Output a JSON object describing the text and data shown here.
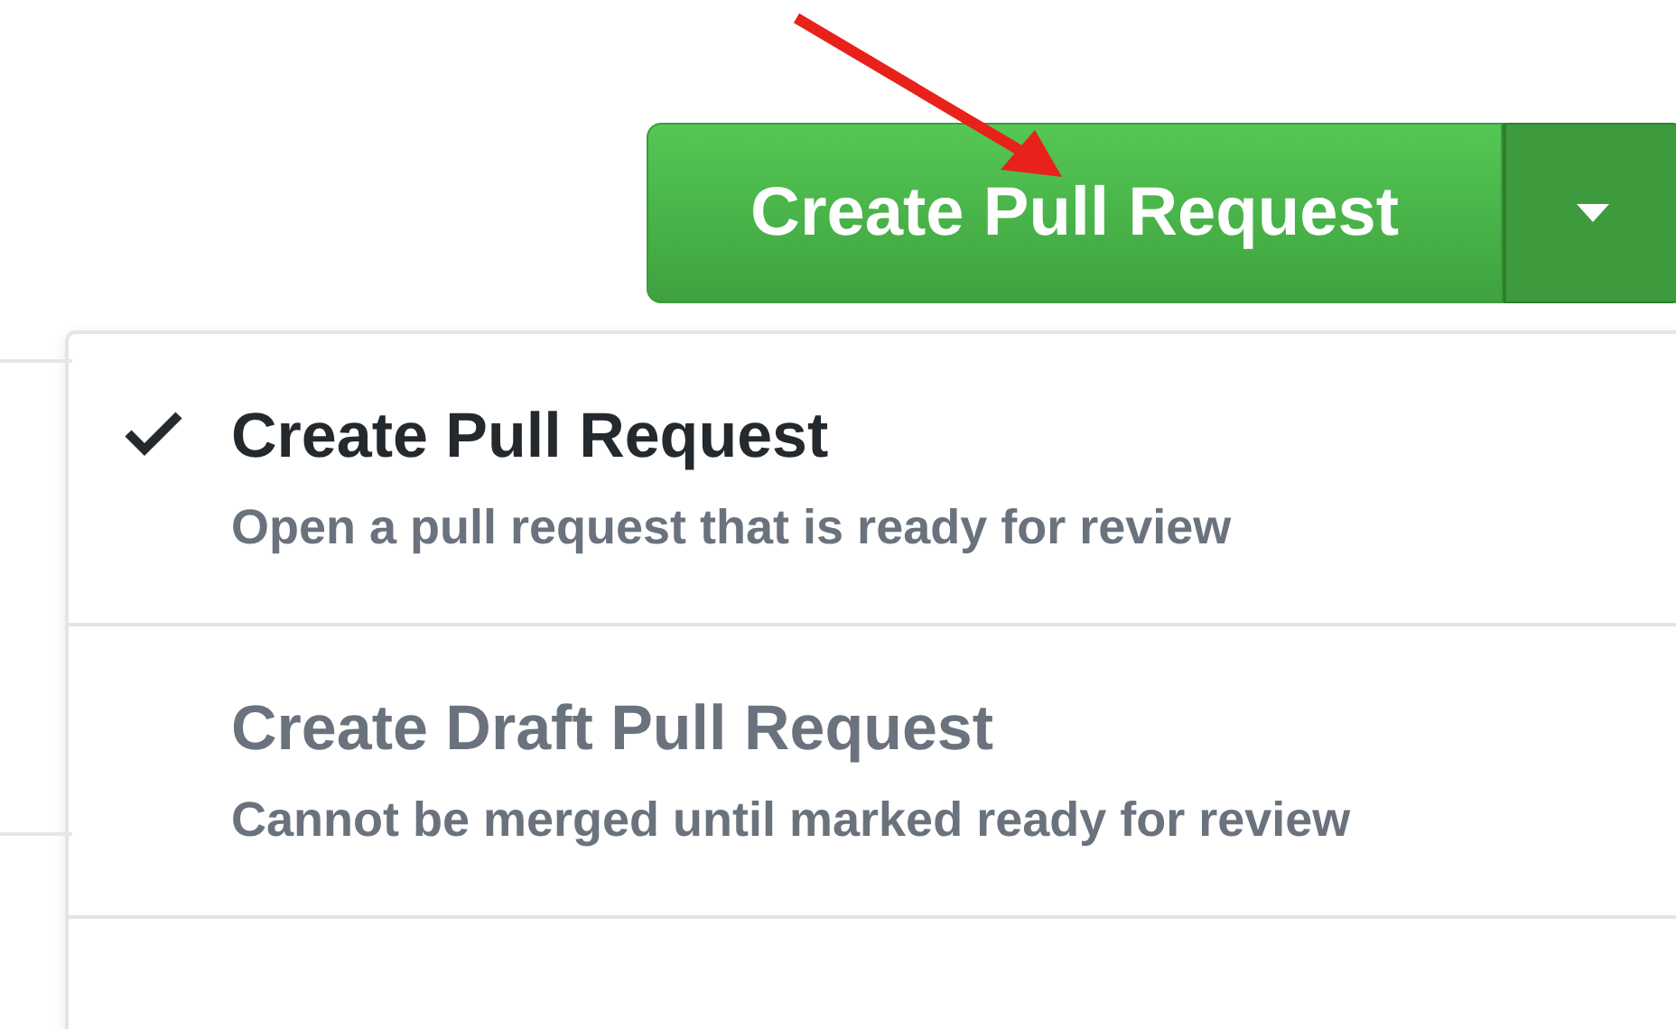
{
  "button": {
    "label": "Create Pull Request"
  },
  "menu": {
    "items": [
      {
        "title": "Create Pull Request",
        "description": "Open a pull request that is ready for review",
        "selected": true
      },
      {
        "title": "Create Draft Pull Request",
        "description": "Cannot be merged until marked ready for review",
        "selected": false
      }
    ]
  }
}
